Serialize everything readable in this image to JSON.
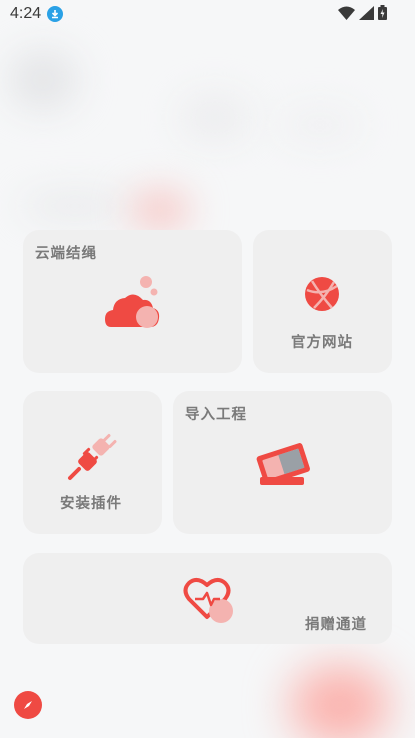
{
  "status_bar": {
    "time": "4:24"
  },
  "cards": {
    "cloud_rope": {
      "title": "云端结绳",
      "icon": "cloud-icon"
    },
    "official_site": {
      "title": "官方网站",
      "icon": "globe-icon"
    },
    "install_plugin": {
      "title": "安装插件",
      "icon": "plug-icon"
    },
    "import_project": {
      "title": "导入工程",
      "icon": "ticket-icon"
    },
    "donate": {
      "title": "捐赠通道",
      "icon": "heart-icon"
    }
  },
  "colors": {
    "accent": "#ef4a43",
    "accent_light": "#f4b3b0",
    "card_bg": "#efefef",
    "page_bg": "#f6f7f8"
  }
}
